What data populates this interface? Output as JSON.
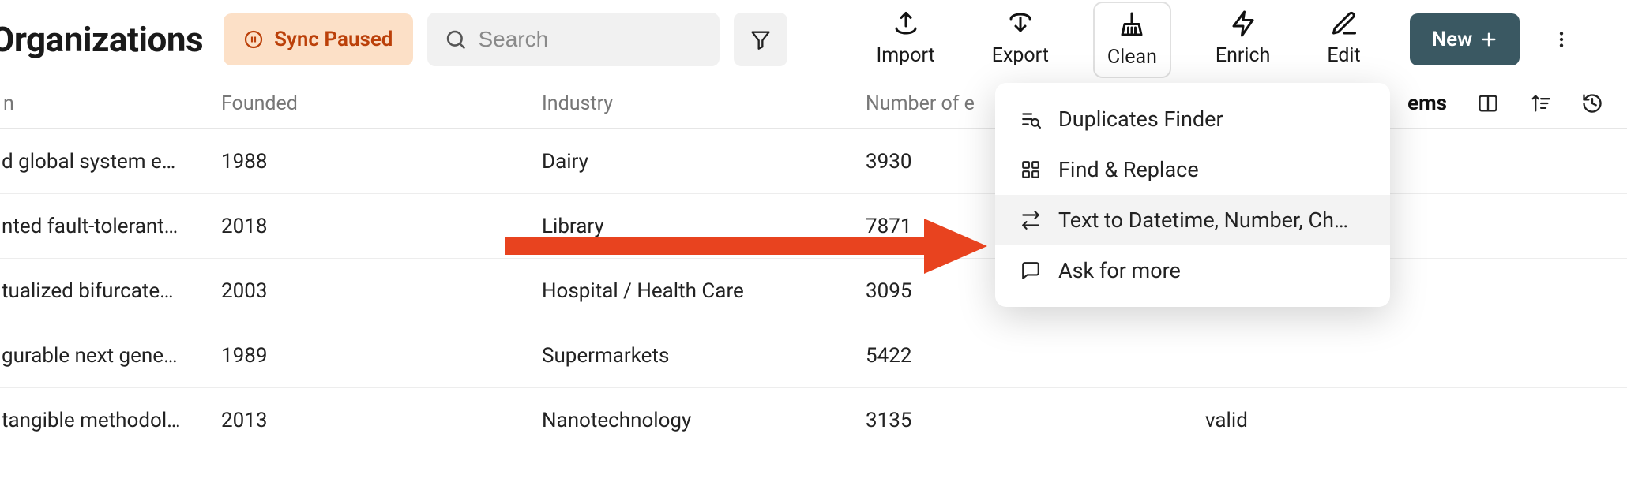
{
  "header": {
    "title": "Organizations",
    "sync_status": "Sync Paused",
    "search_placeholder": "Search"
  },
  "tools": {
    "import": "Import",
    "export": "Export",
    "clean": "Clean",
    "enrich": "Enrich",
    "edit": "Edit",
    "new": "New"
  },
  "columns": {
    "desc": "n",
    "founded": "Founded",
    "industry": "Industry",
    "employees": "Number of e",
    "items_label": "ems"
  },
  "rows": [
    {
      "desc": "d global system e…",
      "founded": "1988",
      "industry": "Dairy",
      "employees": "3930",
      "extra": ""
    },
    {
      "desc": "nted fault-tolerant…",
      "founded": "2018",
      "industry": "Library",
      "employees": "7871",
      "extra": ""
    },
    {
      "desc": "tualized bifurcate…",
      "founded": "2003",
      "industry": "Hospital / Health Care",
      "employees": "3095",
      "extra": ""
    },
    {
      "desc": "gurable next gene…",
      "founded": "1989",
      "industry": "Supermarkets",
      "employees": "5422",
      "extra": ""
    },
    {
      "desc": "tangible methodol…",
      "founded": "2013",
      "industry": "Nanotechnology",
      "employees": "3135",
      "extra": "valid"
    }
  ],
  "clean_menu": {
    "duplicates": "Duplicates Finder",
    "find_replace": "Find & Replace",
    "text_to": "Text to Datetime, Number, Ch…",
    "ask_more": "Ask for more"
  }
}
